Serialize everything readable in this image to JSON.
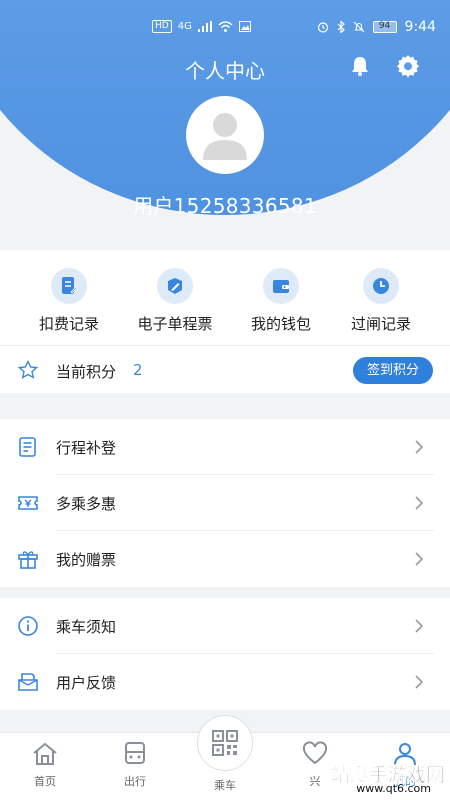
{
  "status_bar": {
    "left_badges": [
      "HD",
      "4G"
    ],
    "battery": "94",
    "time": "9:44"
  },
  "header": {
    "title": "个人中心",
    "username": "用户15258336581"
  },
  "quick_actions": [
    {
      "label": "扣费记录",
      "icon": "receipt-icon"
    },
    {
      "label": "电子单程票",
      "icon": "ticket-edit-icon"
    },
    {
      "label": "我的钱包",
      "icon": "wallet-icon"
    },
    {
      "label": "过闸记录",
      "icon": "clock-icon"
    }
  ],
  "points": {
    "label": "当前积分",
    "value": "2",
    "button": "签到积分"
  },
  "menu_group_1": [
    {
      "label": "行程补登",
      "icon": "trip-document-icon"
    },
    {
      "label": "多乘多惠",
      "icon": "coupon-icon"
    },
    {
      "label": "我的赠票",
      "icon": "gift-icon"
    }
  ],
  "menu_group_2": [
    {
      "label": "乘车须知",
      "icon": "info-icon"
    },
    {
      "label": "用户反馈",
      "icon": "feedback-icon"
    }
  ],
  "bottom_nav": {
    "home": "首页",
    "travel": "出行",
    "ride": "乘车",
    "fourth": "兴",
    "fifth": "我的"
  },
  "watermark": {
    "title": "靖蜓手游戏网",
    "url": "www.qt6.com"
  },
  "colors": {
    "brand_blue": "#2f7fdc",
    "header_blue": "#5d9ce6",
    "icon_blue": "#3a86de"
  }
}
